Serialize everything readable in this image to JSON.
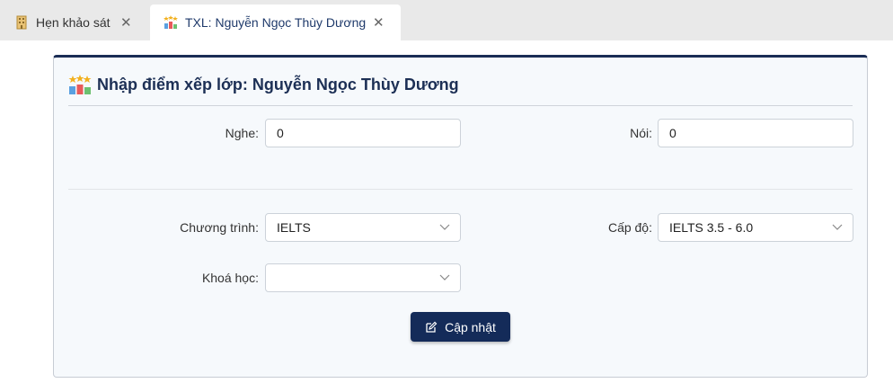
{
  "tabs": [
    {
      "label": "Hẹn khảo sát",
      "icon": "building-icon"
    },
    {
      "label": "TXL: Nguyễn Ngọc Thùy Dương",
      "icon": "podium-stars-icon",
      "active": true
    }
  ],
  "panel": {
    "title": "Nhập điểm xếp lớp: Nguyễn Ngọc Thùy Dương",
    "icon": "podium-stars-icon"
  },
  "form": {
    "nghe": {
      "label": "Nghe:",
      "value": "0"
    },
    "noi": {
      "label": "Nói:",
      "value": "0"
    },
    "chuong_trinh": {
      "label": "Chương trình:",
      "value": "IELTS"
    },
    "cap_do": {
      "label": "Cấp độ:",
      "value": "IELTS 3.5 - 6.0"
    },
    "khoa_hoc": {
      "label": "Khoá học:",
      "value": ""
    }
  },
  "update_button": {
    "label": "Cập nhật",
    "icon": "edit-icon"
  },
  "colors": {
    "primary": "#142b59",
    "panel_bg": "#f6f9fc",
    "tabbar_bg": "#e9e9e9"
  }
}
